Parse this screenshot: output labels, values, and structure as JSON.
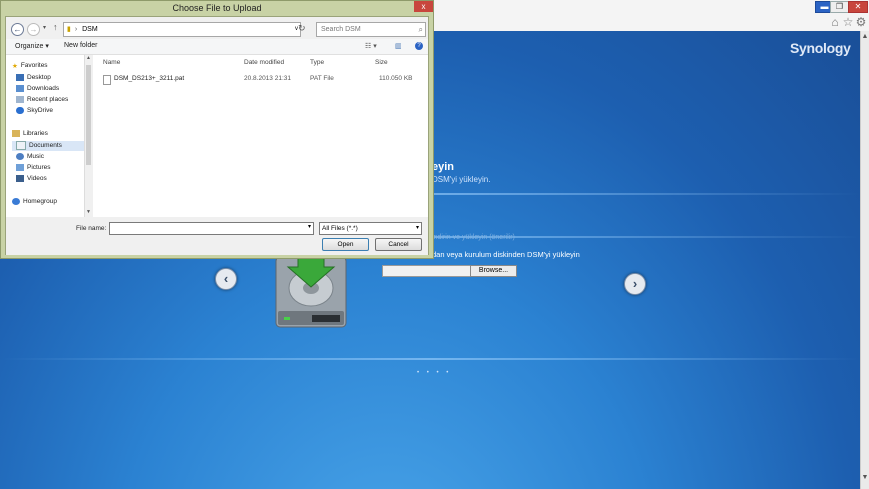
{
  "dialog": {
    "title": "Choose File to Upload",
    "close_symbol": "x",
    "address": {
      "path": "DSM",
      "dropdown": "v"
    },
    "search_placeholder": "Search DSM",
    "toolbar": {
      "organize": "Organize ▾",
      "new_folder": "New folder"
    },
    "nav": {
      "favorites": "Favorites",
      "favorites_items": [
        "Desktop",
        "Downloads",
        "Recent places",
        "SkyDrive"
      ],
      "libraries": "Libraries",
      "libraries_items": [
        "Documents",
        "Music",
        "Pictures",
        "Videos"
      ],
      "homegroup": "Homegroup"
    },
    "columns": {
      "name": "Name",
      "date": "Date modified",
      "type": "Type",
      "size": "Size"
    },
    "files": [
      {
        "name": "DSM_DS213+_3211.pat",
        "date": "20.8.2013 21:31",
        "type": "PAT File",
        "size": "110.050 KB"
      }
    ],
    "file_name_label": "File name:",
    "file_type": "All Files (*.*)",
    "open_label": "Open",
    "cancel_label": "Cancel"
  },
  "synology": {
    "logo": "Synology",
    "title": "eyin",
    "subtitle": "DSM'yi yükleyin.",
    "option1": "indirin ve yükleyin (önerilir)",
    "option2": "dan veya kurulum diskinden DSM'yi yükleyin",
    "browse_label": "Browse...",
    "prev_symbol": "‹",
    "next_symbol": "›",
    "dots": "• • • •"
  },
  "colors": {
    "dialog_frame": "#c8d2a5",
    "synology_blue": "#2b82d2",
    "close_red": "#c8463d",
    "drive_green": "#3aa83a"
  }
}
